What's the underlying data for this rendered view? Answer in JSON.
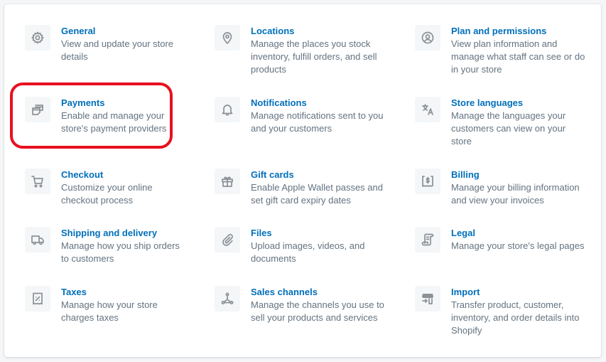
{
  "settings": {
    "items": [
      {
        "title": "General",
        "description": "View and update your store details",
        "icon": "gear-icon"
      },
      {
        "title": "Locations",
        "description": "Manage the places you stock inventory, fulfill orders, and sell products",
        "icon": "location-pin-icon"
      },
      {
        "title": "Plan and permissions",
        "description": "View plan information and manage what staff can see or do in your store",
        "icon": "user-circle-icon"
      },
      {
        "title": "Payments",
        "description": "Enable and manage your store's payment providers",
        "icon": "payments-icon"
      },
      {
        "title": "Notifications",
        "description": "Manage notifications sent to you and your customers",
        "icon": "bell-icon"
      },
      {
        "title": "Store languages",
        "description": "Manage the languages your customers can view on your store",
        "icon": "translate-icon"
      },
      {
        "title": "Checkout",
        "description": "Customize your online checkout process",
        "icon": "cart-icon"
      },
      {
        "title": "Gift cards",
        "description": "Enable Apple Wallet passes and set gift card expiry dates",
        "icon": "gift-icon"
      },
      {
        "title": "Billing",
        "description": "Manage your billing information and view your invoices",
        "icon": "billing-receipt-icon"
      },
      {
        "title": "Shipping and delivery",
        "description": "Manage how you ship orders to customers",
        "icon": "truck-icon"
      },
      {
        "title": "Files",
        "description": "Upload images, videos, and documents",
        "icon": "paperclip-icon"
      },
      {
        "title": "Legal",
        "description": "Manage your store's legal pages",
        "icon": "legal-scroll-icon"
      },
      {
        "title": "Taxes",
        "description": "Manage how your store charges taxes",
        "icon": "tax-receipt-icon"
      },
      {
        "title": "Sales channels",
        "description": "Manage the channels you use to sell your products and services",
        "icon": "sales-channels-icon"
      },
      {
        "title": "Import",
        "description": "Transfer product, customer, inventory, and order details into Shopify",
        "icon": "import-store-icon"
      }
    ],
    "highlighted_item": "Payments"
  },
  "colors": {
    "title": "#006fbb",
    "description": "#637381",
    "icon": "#8c9196",
    "highlight": "#e8101f"
  }
}
